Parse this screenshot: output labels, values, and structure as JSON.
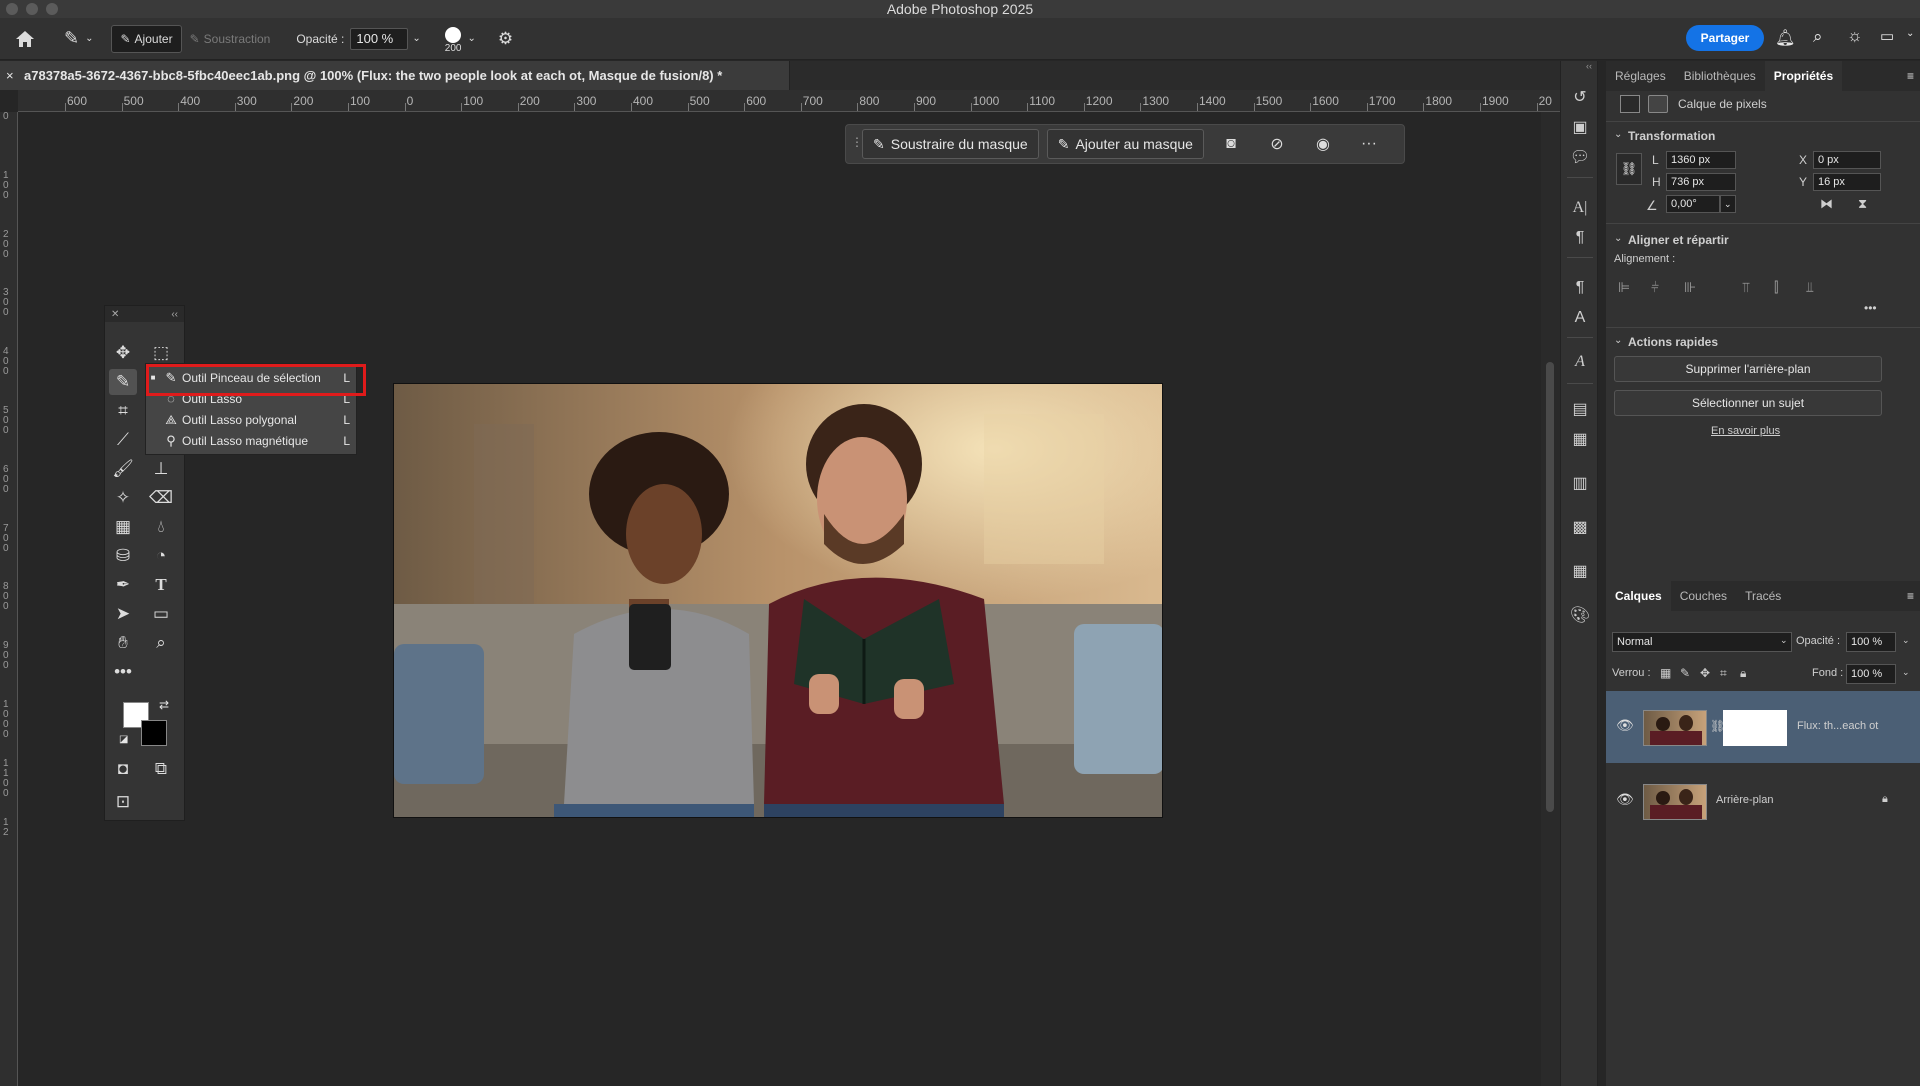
{
  "app": {
    "title": "Adobe Photoshop 2025"
  },
  "options_bar": {
    "add_label": "Ajouter",
    "subtract_label": "Soustraction",
    "opacity_label": "Opacité :",
    "opacity_value": "100 %",
    "brush_size": "200",
    "share_label": "Partager"
  },
  "document": {
    "tab_title": "a78378a5-3672-4367-bbc8-5fbc40eec1ab.png @ 100% (Flux: the two people look at each ot, Masque de fusion/8) *",
    "close_glyph": "×"
  },
  "ruler": {
    "h_ticks": [
      "600",
      "500",
      "400",
      "300",
      "200",
      "100",
      "0",
      "100",
      "200",
      "300",
      "400",
      "500",
      "600",
      "700",
      "800",
      "900",
      "1000",
      "1100",
      "1200",
      "1300",
      "1400",
      "1500",
      "1600",
      "1700",
      "1800",
      "1900",
      "20"
    ],
    "v_ticks": [
      "0",
      "1 0 0",
      "2 0 0",
      "3 0 0",
      "4 0 0",
      "5 0 0",
      "6 0 0",
      "7 0 0",
      "8 0 0",
      "9 0 0",
      "1 0 0 0",
      "1 1 0 0",
      "1 2"
    ]
  },
  "task_bar": {
    "subtract_mask": "Soustraire du masque",
    "add_mask": "Ajouter au masque",
    "more": "···"
  },
  "tool_flyout": {
    "items": [
      {
        "label": "Outil Pinceau de sélection",
        "key": "L"
      },
      {
        "label": "Outil Lasso",
        "key": "L"
      },
      {
        "label": "Outil Lasso polygonal",
        "key": "L"
      },
      {
        "label": "Outil Lasso magnétique",
        "key": "L"
      }
    ]
  },
  "panels": {
    "top_tabs": [
      "Réglages",
      "Bibliothèques",
      "Propriétés"
    ],
    "layer_type": "Calque de pixels",
    "transform": {
      "title": "Transformation",
      "w_label": "L",
      "w_value": "1360 px",
      "h_label": "H",
      "h_value": "736 px",
      "x_label": "X",
      "x_value": "0 px",
      "y_label": "Y",
      "y_value": "16 px",
      "angle_value": "0,00°"
    },
    "align": {
      "title": "Aligner et répartir",
      "sub": "Alignement :"
    },
    "quick_actions": {
      "title": "Actions rapides",
      "remove_bg": "Supprimer l'arrière-plan",
      "select_subject": "Sélectionner un sujet",
      "learn_more": "En savoir plus"
    },
    "layers_tabs": [
      "Calques",
      "Couches",
      "Tracés"
    ],
    "blend_mode": "Normal",
    "opacity_label": "Opacité :",
    "opacity_value": "100 %",
    "lock_label": "Verrou :",
    "fill_label": "Fond :",
    "fill_value": "100 %",
    "layers": [
      {
        "name": "Flux: th...each ot"
      },
      {
        "name": "Arrière-plan"
      }
    ]
  },
  "colors": {
    "accent": "#1473e6",
    "highlight": "#e01b1b",
    "layer_selected": "#4b5f75"
  }
}
